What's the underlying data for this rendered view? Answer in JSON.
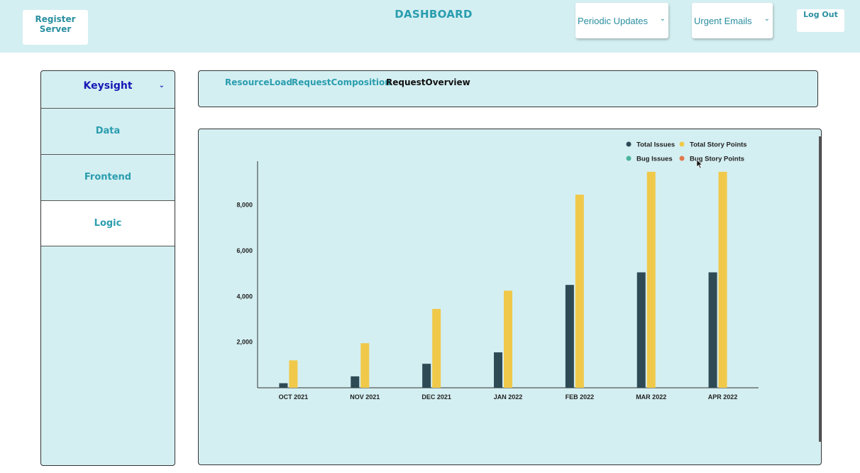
{
  "header": {
    "register_label": "Register Server",
    "title": "DASHBOARD",
    "periodic_select": "Periodic Updates",
    "urgent_select": "Urgent Emails",
    "logout_label": "Log Out"
  },
  "sidebar": {
    "brand": "Keysight",
    "items": [
      {
        "label": "Data"
      },
      {
        "label": "Frontend"
      },
      {
        "label": "Logic"
      }
    ]
  },
  "tabs": [
    {
      "label": "ResourceLoad"
    },
    {
      "label": "RequestComposition"
    },
    {
      "label": "RequestOverview"
    }
  ],
  "colors": {
    "total_issues": "#2d4a55",
    "total_story_points": "#f0c94a",
    "bug_issues": "#4cb49c",
    "bug_story_points": "#e07a4f"
  },
  "chart_data": {
    "type": "bar",
    "categories": [
      "OCT 2021",
      "NOV 2021",
      "DEC 2021",
      "JAN 2022",
      "FEB 2022",
      "MAR 2022",
      "APR 2022"
    ],
    "series": [
      {
        "name": "Total Issues",
        "values": [
          200,
          500,
          1050,
          1550,
          4500,
          5050,
          5050
        ]
      },
      {
        "name": "Total Story Points",
        "values": [
          1200,
          1950,
          3450,
          4250,
          8450,
          9450,
          9450
        ]
      },
      {
        "name": "Bug Issues",
        "values": [
          0,
          0,
          0,
          0,
          0,
          0,
          0
        ]
      },
      {
        "name": "Bug Story Points",
        "values": [
          0,
          0,
          0,
          0,
          0,
          0,
          0
        ]
      }
    ],
    "yticks": [
      "2,000",
      "4,000",
      "6,000",
      "8,000"
    ],
    "ylim": [
      0,
      9850
    ],
    "legend_position": "top-right",
    "grid": false
  }
}
